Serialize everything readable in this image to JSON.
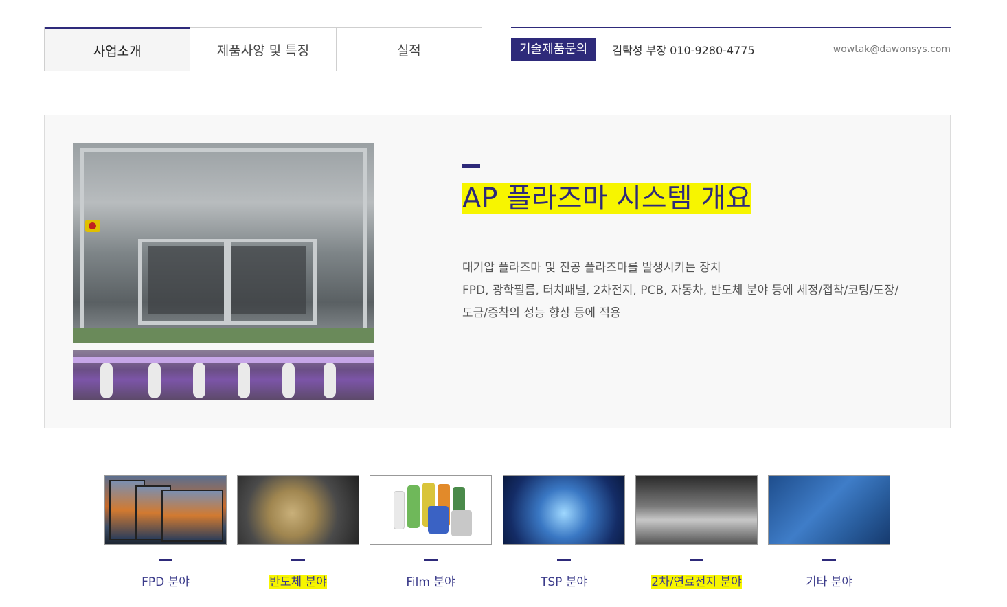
{
  "tabs": [
    {
      "label": "사업소개",
      "active": true
    },
    {
      "label": "제품사양 및 특징",
      "active": false
    },
    {
      "label": "실적",
      "active": false
    }
  ],
  "contact": {
    "badge": "기술제품문의",
    "person": "김탁성 부장 010-9280-4775",
    "email": "wowtak@dawonsys.com"
  },
  "overview": {
    "title": "AP 플라즈마 시스템 개요",
    "line1": "대기압 플라즈마 및 진공 플라즈마를 발생시키는 장치",
    "line2": "FPD, 광학필름, 터치패널, 2차전지, PCB, 자동차, 반도체 분야 등에 세정/접착/코팅/도장/",
    "line3": "도금/증착의 성능 향상 등에 적용"
  },
  "fields": [
    {
      "label": "FPD 분야"
    },
    {
      "label": "반도체 분야"
    },
    {
      "label": "Film 분야"
    },
    {
      "label": "TSP 분야"
    },
    {
      "label": "2차/연료전지 분야"
    },
    {
      "label": "기타 분야"
    }
  ],
  "colors": {
    "accent": "#2e2a7a",
    "highlight": "#f7f500"
  }
}
